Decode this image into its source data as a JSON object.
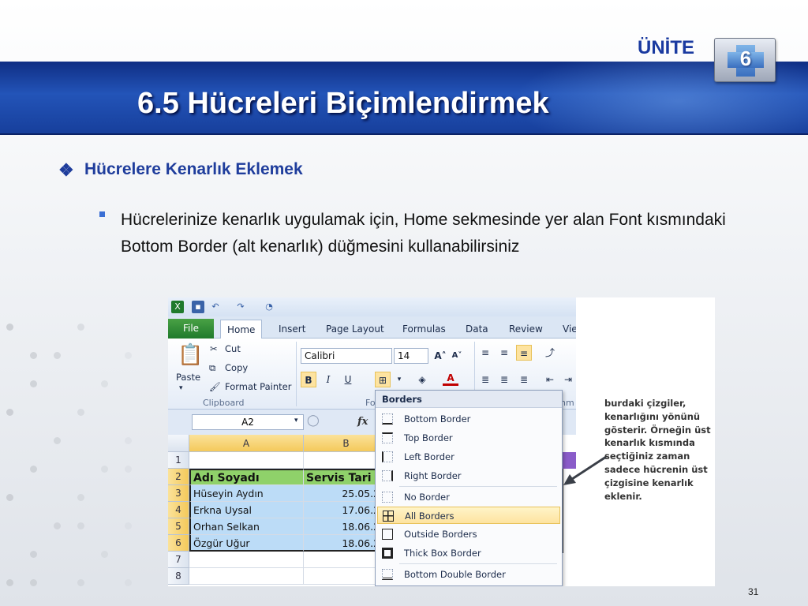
{
  "header": {
    "unit_label": "ÜNİTE",
    "unit_number": "6",
    "title": "6.5 Hücreleri Biçimlendirmek"
  },
  "section": {
    "bullet": "❖",
    "title": "Hücrelere Kenarlık Eklemek",
    "body": "Hücrelerinize kenarlık uygulamak için, Home sekmesinde yer alan  Font kısmındaki Bottom Border (alt kenarlık) düğmesini kullanabilirsiniz"
  },
  "excel": {
    "tabs": [
      "File",
      "Home",
      "Insert",
      "Page Layout",
      "Formulas",
      "Data",
      "Review",
      "Vie"
    ],
    "active_tab": "Home",
    "clipboard": {
      "paste": "Paste",
      "cut": "Cut",
      "copy": "Copy",
      "format_painter": "Format Painter",
      "group_label": "Clipboard"
    },
    "font": {
      "name": "Calibri",
      "size": "14",
      "bold": "B",
      "italic": "I",
      "underline": "U",
      "group_label": "Fo"
    },
    "alignment_group_label": "gnm",
    "name_box": "A2",
    "fx": "fx",
    "columns": [
      "A",
      "B"
    ],
    "rows": [
      "1",
      "2",
      "3",
      "4",
      "5",
      "6",
      "7",
      "8"
    ],
    "cells": {
      "header": [
        "Adı Soyadı",
        "Servis Tari"
      ],
      "data": [
        [
          "Hüseyin Aydın",
          "25.05.20"
        ],
        [
          "Erkna Uysal",
          "17.06.20"
        ],
        [
          "Orhan Selkan",
          "18.06.20"
        ],
        [
          "Özgür Uğur",
          "18.06.20"
        ]
      ]
    },
    "borders_menu": {
      "title": "Borders",
      "items": [
        "Bottom Border",
        "Top Border",
        "Left Border",
        "Right Border",
        "No Border",
        "All Borders",
        "Outside Borders",
        "Thick Box Border",
        "Bottom Double Border"
      ],
      "highlighted": "All Borders"
    }
  },
  "annotation": "burdaki çizgiler, kenarlığını yönünü gösterir. Örneğin üst kenarlık kısmında seçtiğiniz zaman sadece hücrenin üst çizgisine kenarlık eklenir.",
  "page_number": "31",
  "colors": {
    "accent_blue": "#1f3d9c",
    "header_green": "#8fd16a",
    "data_blue": "#bcdcf7",
    "file_tab_green": "#2e8b3a"
  }
}
